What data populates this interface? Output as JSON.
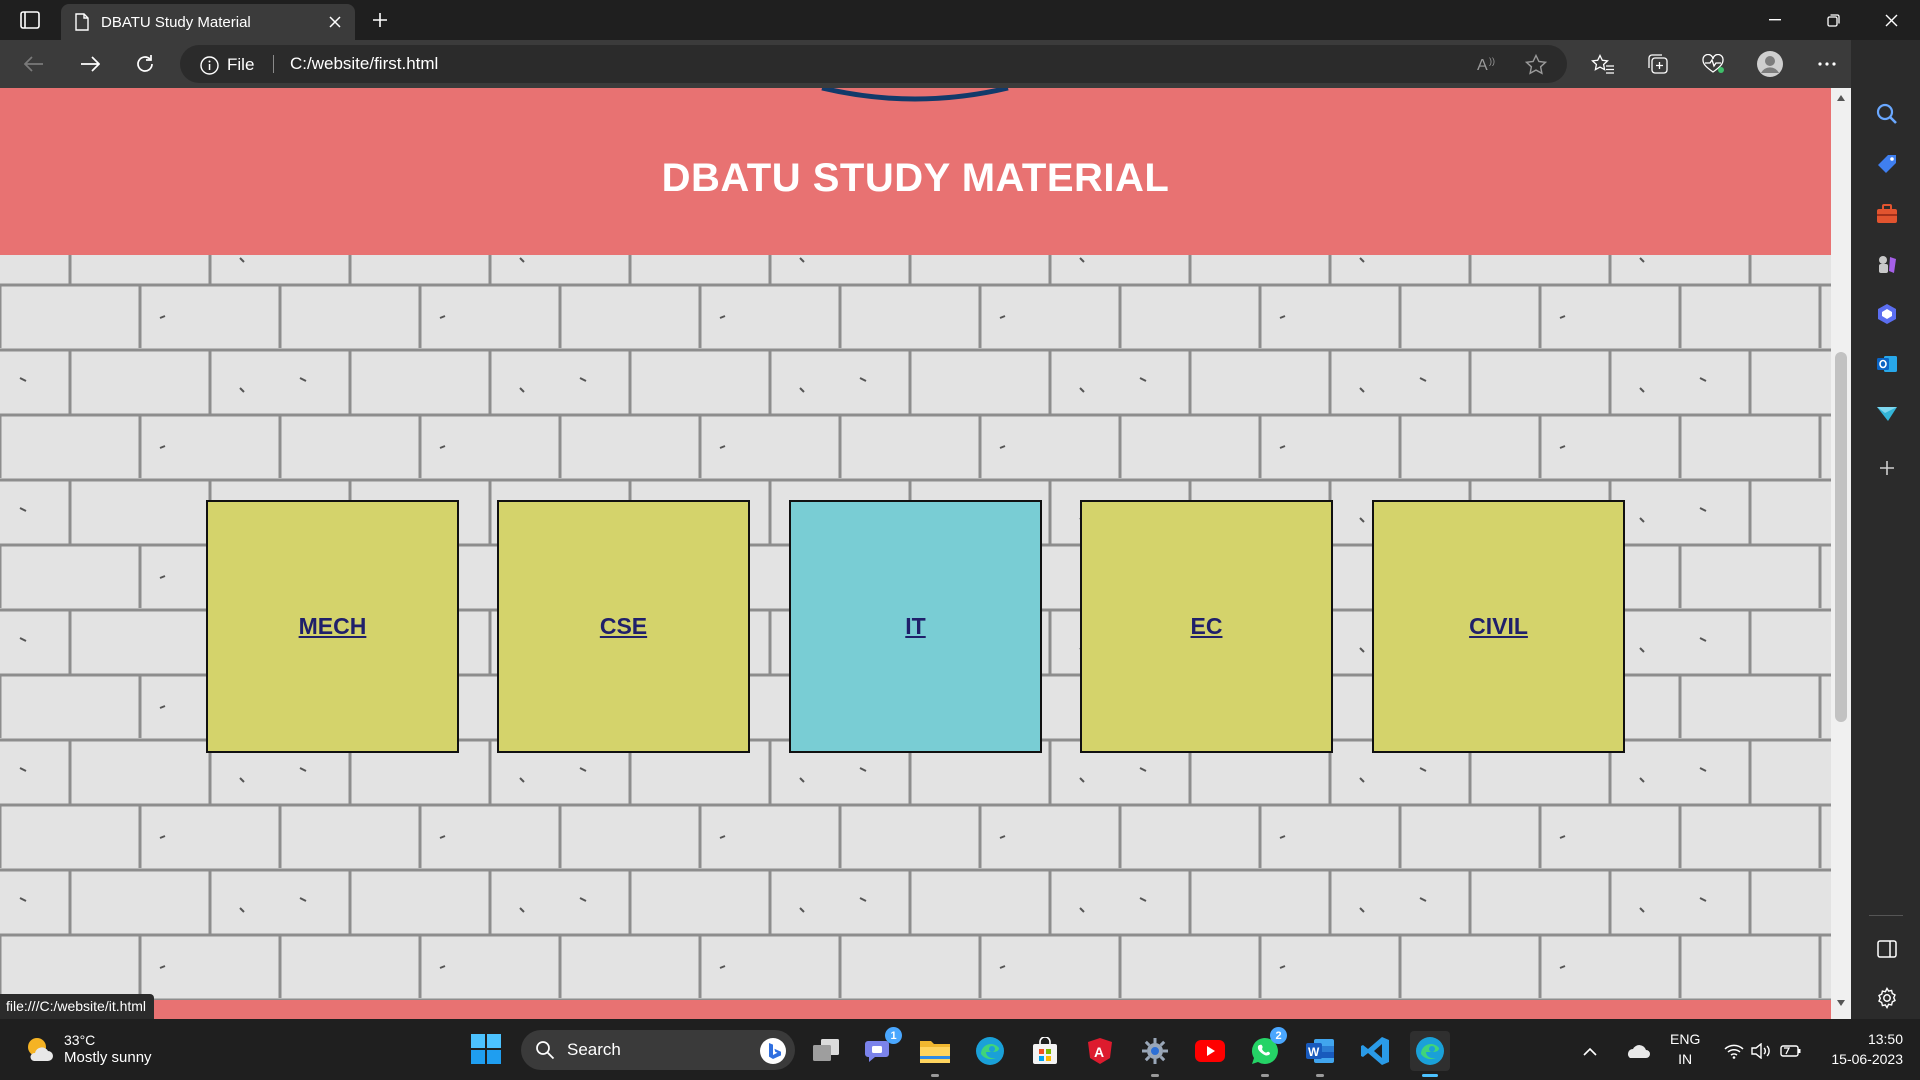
{
  "browser": {
    "tab_title": "DBATU Study Material",
    "address_label": "File",
    "url": "C:/website/first.html",
    "status_url": "file:///C:/website/it.html"
  },
  "page": {
    "title": "DBATU STUDY MATERIAL",
    "cards": [
      {
        "label": "MECH",
        "color": "#d4d36b",
        "hovered": false
      },
      {
        "label": "CSE",
        "color": "#d4d36b",
        "hovered": false
      },
      {
        "label": "IT",
        "color": "#79cdd4",
        "hovered": true
      },
      {
        "label": "EC",
        "color": "#d4d36b",
        "hovered": false
      },
      {
        "label": "CIVIL",
        "color": "#d4d36b",
        "hovered": false
      }
    ],
    "header_color": "#e87272"
  },
  "taskbar": {
    "weather_temp": "33°C",
    "weather_condition": "Mostly sunny",
    "search_label": "Search",
    "teams_badge": "1",
    "whatsapp_badge": "2",
    "language": "ENG",
    "region": "IN",
    "time": "13:50",
    "date": "15-06-2023"
  }
}
